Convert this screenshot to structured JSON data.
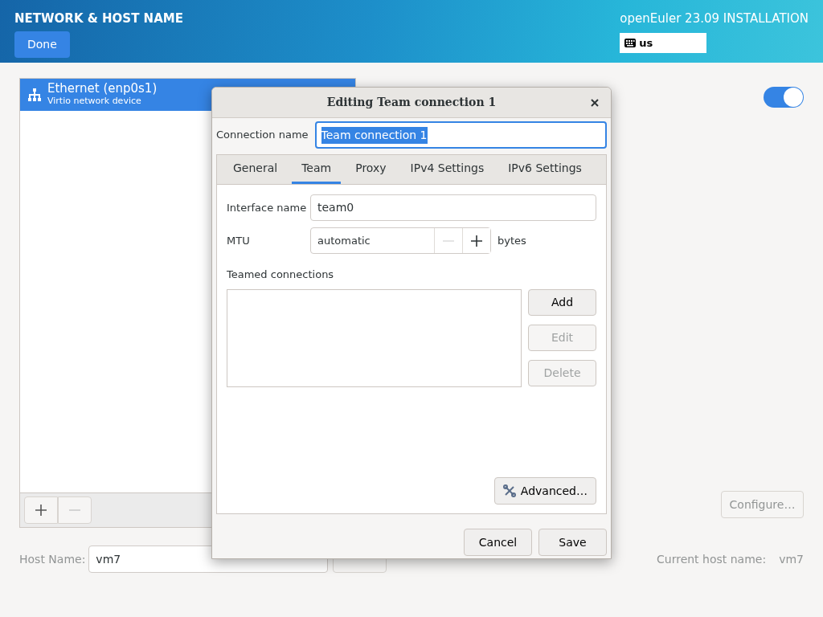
{
  "header": {
    "title": "NETWORK & HOST NAME",
    "done_button": "Done",
    "product": "openEuler 23.09 INSTALLATION",
    "keyboard_layout": "us"
  },
  "devices": [
    {
      "name": "Ethernet (enp0s1)",
      "description": "Virtio network device",
      "selected": true
    }
  ],
  "device_switch": {
    "on": true
  },
  "configure_button": {
    "label": "Configure…",
    "disabled": true
  },
  "host_name": {
    "label": "Host Name:",
    "value": "vm7",
    "current_label": "Current host name:",
    "current_value": "vm7"
  },
  "dialog": {
    "title": "Editing Team connection 1",
    "connection_name_label": "Connection name",
    "connection_name": "Team connection 1",
    "connection_name_selected": true,
    "tabs": [
      {
        "label": "General",
        "selected": false
      },
      {
        "label": "Team",
        "selected": true
      },
      {
        "label": "Proxy",
        "selected": false
      },
      {
        "label": "IPv4 Settings",
        "selected": false
      },
      {
        "label": "IPv6 Settings",
        "selected": false
      }
    ],
    "interface_label": "Interface name",
    "interface_value": "team0",
    "mtu_label": "MTU",
    "mtu_value": "automatic",
    "mtu_unit": "bytes",
    "teamed_label": "Teamed connections",
    "side_buttons": [
      {
        "label": "Add",
        "disabled": false
      },
      {
        "label": "Edit",
        "disabled": true
      },
      {
        "label": "Delete",
        "disabled": true
      }
    ],
    "advanced_button": "Advanced…",
    "buttons": [
      "Cancel",
      "Save"
    ]
  }
}
